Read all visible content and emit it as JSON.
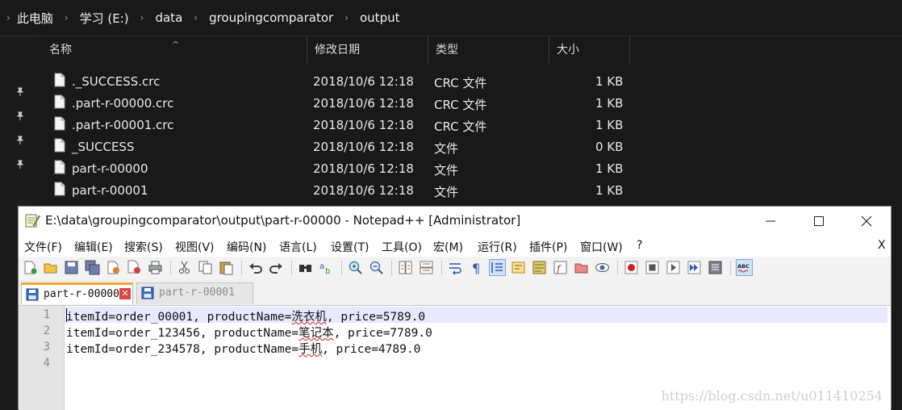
{
  "explorer": {
    "breadcrumb": [
      "此电脑",
      "学习 (E:)",
      "data",
      "groupingcomparator",
      "output"
    ],
    "columns": [
      "名称",
      "修改日期",
      "类型",
      "大小"
    ],
    "files": [
      {
        "name": "._SUCCESS.crc",
        "date": "2018/10/6 12:18",
        "type": "CRC 文件",
        "size": "1 KB"
      },
      {
        "name": ".part-r-00000.crc",
        "date": "2018/10/6 12:18",
        "type": "CRC 文件",
        "size": "1 KB"
      },
      {
        "name": ".part-r-00001.crc",
        "date": "2018/10/6 12:18",
        "type": "CRC 文件",
        "size": "1 KB"
      },
      {
        "name": "_SUCCESS",
        "date": "2018/10/6 12:18",
        "type": "文件",
        "size": "0 KB"
      },
      {
        "name": "part-r-00000",
        "date": "2018/10/6 12:18",
        "type": "文件",
        "size": "1 KB"
      },
      {
        "name": "part-r-00001",
        "date": "2018/10/6 12:18",
        "type": "文件",
        "size": "1 KB"
      }
    ]
  },
  "notepad": {
    "title": "E:\\data\\groupingcomparator\\output\\part-r-00000 - Notepad++ [Administrator]",
    "menu": [
      "文件(F)",
      "编辑(E)",
      "搜索(S)",
      "视图(V)",
      "编码(N)",
      "语言(L)",
      "设置(T)",
      "工具(O)",
      "宏(M)",
      "运行(R)",
      "插件(P)",
      "窗口(W)",
      "?"
    ],
    "menu_close": "X",
    "tabs": [
      {
        "label": "part-r-00000",
        "active": true,
        "close": "✕"
      },
      {
        "label": "part-r-00001",
        "active": false
      }
    ],
    "line_numbers": [
      "1",
      "2",
      "3",
      "4"
    ],
    "lines": [
      {
        "a": "itemId=order_00001, productName=",
        "b": "洗衣机",
        "c": ", price=5789.0"
      },
      {
        "a": "itemId=order_123456, productName=",
        "b": "笔记本",
        "c": ", price=7789.0"
      },
      {
        "a": "itemId=order_234578, productName=",
        "b": "手机",
        "c": ", price=4789.0"
      },
      {
        "a": "",
        "b": "",
        "c": ""
      }
    ],
    "watermark": "https://blog.csdn.net/u011410254"
  },
  "colors": {
    "explorer_bg": "#191919",
    "tab_accent": "#f7a43a",
    "current_line": "#e8e8ff",
    "close_red": "#d44444"
  },
  "icons": [
    "pin-icon",
    "file-icon",
    "notepadpp-icon",
    "minimize-icon",
    "maximize-icon",
    "close-icon",
    "floppy-disk-icon"
  ]
}
